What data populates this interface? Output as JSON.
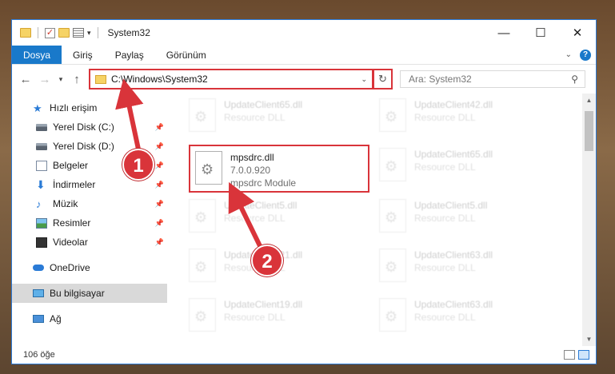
{
  "window": {
    "title": "System32",
    "controls": {
      "minimize": "—",
      "maximize": "☐",
      "close": "✕"
    }
  },
  "ribbon": {
    "tabs": [
      "Dosya",
      "Giriş",
      "Paylaş",
      "Görünüm"
    ],
    "help": "?"
  },
  "address": {
    "path": "C:\\Windows\\System32",
    "search_placeholder": "Ara: System32"
  },
  "sidebar": {
    "quick_access": "Hızlı erişim",
    "items": [
      {
        "label": "Yerel Disk (C:)",
        "icon": "drive-icon",
        "pinned": true
      },
      {
        "label": "Yerel Disk (D:)",
        "icon": "drive-icon",
        "pinned": true
      },
      {
        "label": "Belgeler",
        "icon": "documents-icon",
        "pinned": true
      },
      {
        "label": "İndirmeler",
        "icon": "downloads-icon",
        "pinned": true
      },
      {
        "label": "Müzik",
        "icon": "music-icon",
        "pinned": true
      },
      {
        "label": "Resimler",
        "icon": "pictures-icon",
        "pinned": true
      },
      {
        "label": "Videolar",
        "icon": "videos-icon",
        "pinned": true
      }
    ],
    "onedrive": "OneDrive",
    "this_pc": "Bu bilgisayar",
    "network": "Ağ"
  },
  "files": {
    "focused": {
      "name": "mpsdrc.dll",
      "version": "7.0.0.920",
      "description": "mpsdrc Module"
    },
    "left_column": [
      {
        "name": "UpdateClient65.dll",
        "type": "Resource DLL"
      },
      {
        "name": "UpdateClient5.dll",
        "type": "Resource DLL"
      },
      {
        "name": "UpdateClient21.dll",
        "type": "Resource DLL"
      },
      {
        "name": "UpdateClient19.dll",
        "type": "Resource DLL"
      }
    ],
    "right_column": [
      {
        "name": "UpdateClient42.dll",
        "type": "Resource DLL"
      },
      {
        "name": "UpdateClient65.dll",
        "type": "Resource DLL"
      },
      {
        "name": "UpdateClient5.dll",
        "type": "Resource DLL"
      },
      {
        "name": "UpdateClient63.dll",
        "type": "Resource DLL"
      },
      {
        "name": "UpdateClient63.dll",
        "type": "Resource DLL"
      }
    ]
  },
  "status": {
    "count": "106 öğe"
  },
  "annotations": {
    "step1": "1",
    "step2": "2",
    "highlight_color": "#d9343a"
  }
}
